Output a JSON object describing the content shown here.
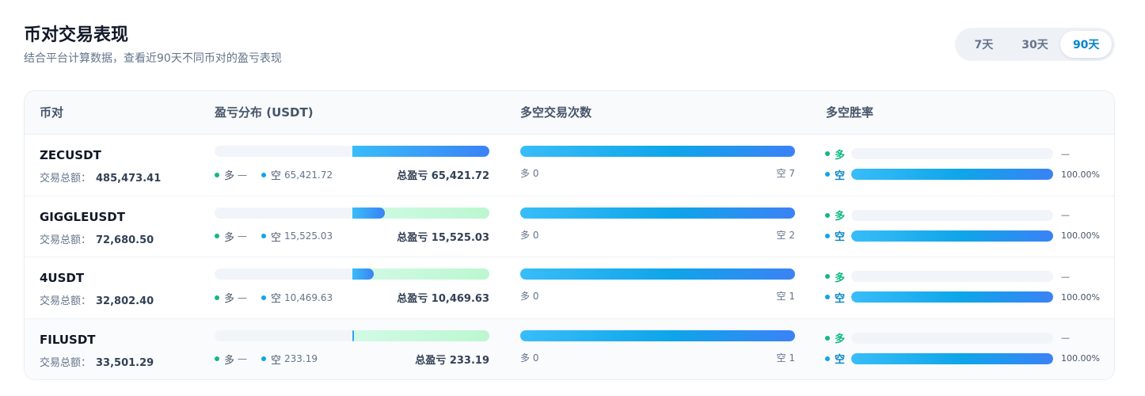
{
  "header": {
    "title": "币对交易表现",
    "subtitle": "结合平台计算数据，查看近90天不同币对的盈亏表现"
  },
  "range": {
    "options": [
      "7天",
      "30天",
      "90天"
    ],
    "active": "90天"
  },
  "table": {
    "columns": [
      "币对",
      "盈亏分布 (USDT)",
      "多空交易次数",
      "多空胜率"
    ],
    "volume_label": "交易总额：",
    "long_label": "多",
    "short_label": "空",
    "rows": [
      {
        "symbol": "ZECUSDT",
        "volume": "485,473.41",
        "long_pnl": "—",
        "short_pnl": "65,421.72",
        "total": "总盈亏 65,421.72",
        "short_pnl_fraction": 1.0,
        "long_count": "多 0",
        "short_count": "空 7",
        "long_win": "—",
        "short_win": "100.00%",
        "short_win_fraction": 1.0
      },
      {
        "symbol": "GIGGLEUSDT",
        "volume": "72,680.50",
        "long_pnl": "—",
        "short_pnl": "15,525.03",
        "total": "总盈亏 15,525.03",
        "short_pnl_fraction": 0.24,
        "long_count": "多 0",
        "short_count": "空 2",
        "long_win": "—",
        "short_win": "100.00%",
        "short_win_fraction": 1.0
      },
      {
        "symbol": "4USDT",
        "volume": "32,802.40",
        "long_pnl": "—",
        "short_pnl": "10,469.63",
        "total": "总盈亏 10,469.63",
        "short_pnl_fraction": 0.16,
        "long_count": "多 0",
        "short_count": "空 1",
        "long_win": "—",
        "short_win": "100.00%",
        "short_win_fraction": 1.0
      },
      {
        "symbol": "FILUSDT",
        "volume": "33,501.29",
        "long_pnl": "—",
        "short_pnl": "233.19",
        "total": "总盈亏 233.19",
        "short_pnl_fraction": 0.01,
        "long_count": "多 0",
        "short_count": "空 1",
        "long_win": "—",
        "short_win": "100.00%",
        "short_win_fraction": 1.0
      }
    ]
  }
}
